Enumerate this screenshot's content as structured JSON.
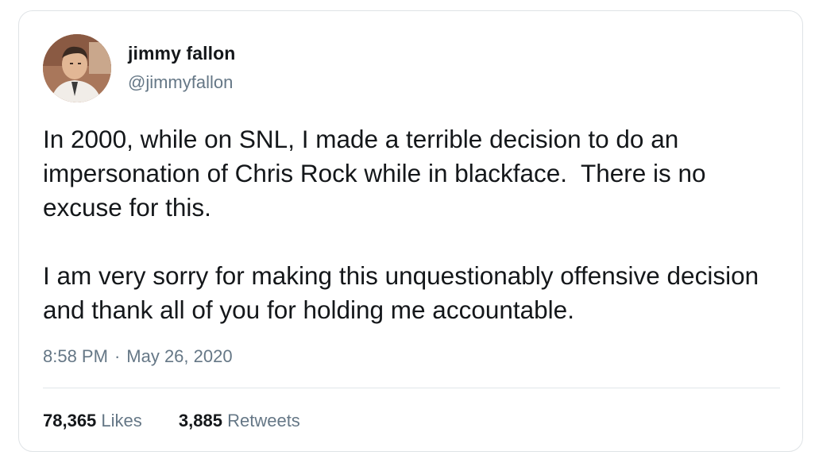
{
  "tweet": {
    "author_name": "jimmy fallon",
    "author_handle": "@jimmyfallon",
    "paragraphs": [
      "In 2000, while on SNL, I made a terrible decision to do an impersonation of Chris Rock while in blackface.  There is no excuse for this.",
      "I am very sorry for making this unquestionably offensive decision and thank all of you for holding me accountable."
    ],
    "time": "8:58 PM",
    "separator": "·",
    "date": "May 26, 2020",
    "stats": {
      "likes_count": "78,365",
      "likes_label": "Likes",
      "retweets_count": "3,885",
      "retweets_label": "Retweets"
    }
  },
  "colors": {
    "text_primary": "#14171a",
    "text_secondary": "#657786",
    "border": "#dfe3e6"
  }
}
